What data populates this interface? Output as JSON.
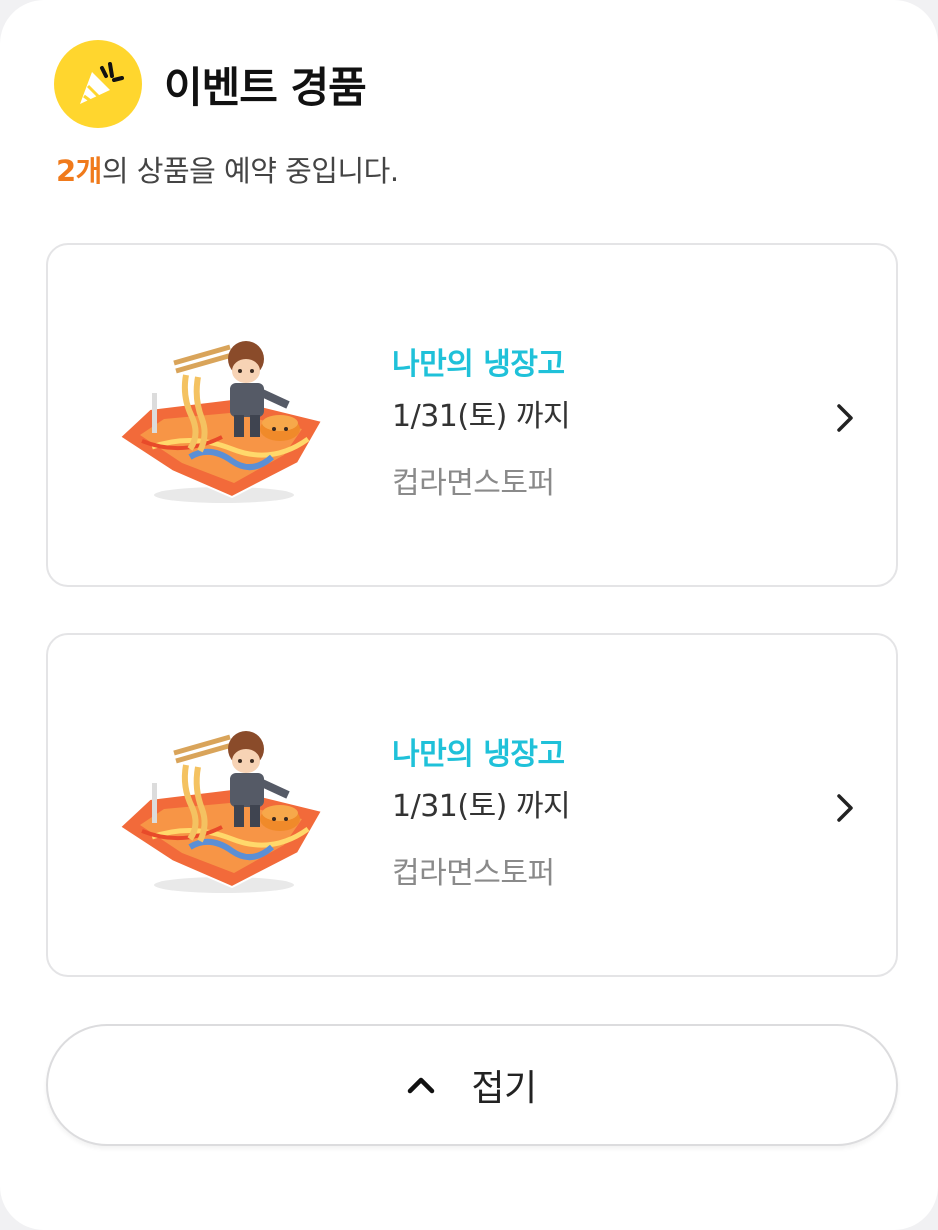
{
  "header": {
    "icon": "party-popper-icon",
    "title": "이벤트 경품"
  },
  "summary": {
    "count": "2개",
    "text": "의 상품을 예약 중입니다."
  },
  "items": [
    {
      "title": "나만의 냉장고",
      "date": "1/31(토) 까지",
      "name": "컵라면스토퍼",
      "image": "acrylic-stand-image"
    },
    {
      "title": "나만의 냉장고",
      "date": "1/31(토) 까지",
      "name": "컵라면스토퍼",
      "image": "acrylic-stand-image"
    }
  ],
  "fold_button": {
    "icon": "chevron-up-icon",
    "label": "접기"
  },
  "colors": {
    "accent_count": "#f07a1b",
    "accent_title": "#1fc1d9",
    "icon_bg": "#ffd62e"
  }
}
